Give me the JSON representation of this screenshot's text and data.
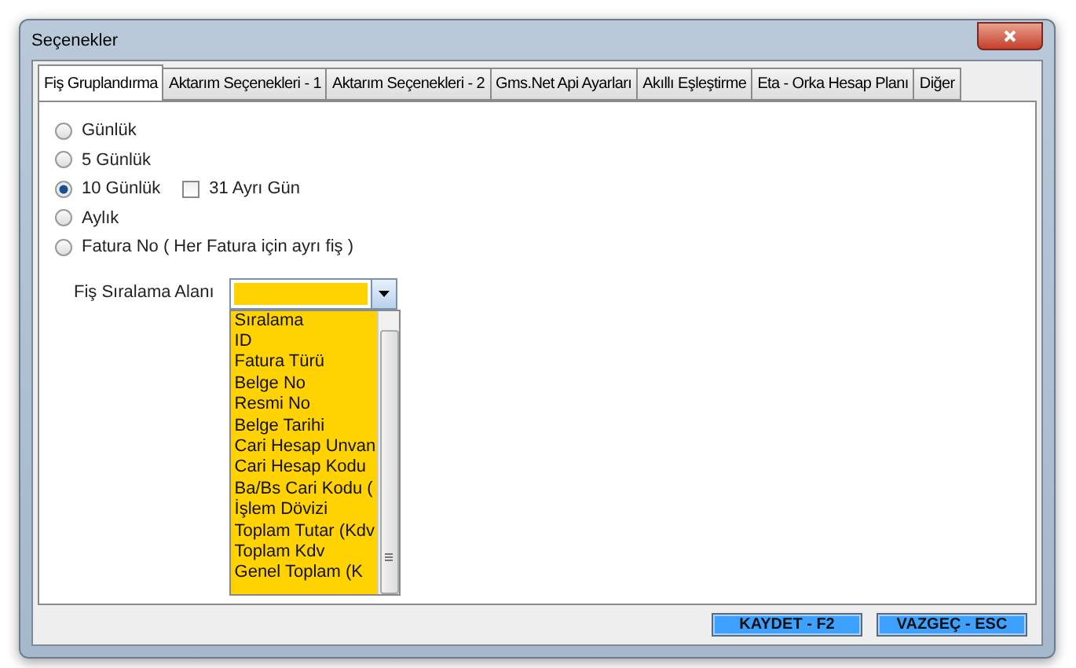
{
  "window": {
    "title": "Seçenekler"
  },
  "tabs": [
    {
      "label": "Fiş Gruplandırma",
      "selected": true
    },
    {
      "label": "Aktarım Seçenekleri - 1",
      "selected": false
    },
    {
      "label": "Aktarım Seçenekleri - 2",
      "selected": false
    },
    {
      "label": "Gms.Net Api Ayarları",
      "selected": false
    },
    {
      "label": "Akıllı Eşleştirme",
      "selected": false
    },
    {
      "label": "Eta - Orka Hesap Planı",
      "selected": false
    },
    {
      "label": "Diğer",
      "selected": false
    }
  ],
  "options": [
    {
      "kind": "radio",
      "label": "Günlük",
      "selected": false
    },
    {
      "kind": "radio",
      "label": "5 Günlük",
      "selected": false
    },
    {
      "kind": "radio",
      "label": "10 Günlük",
      "selected": true,
      "extra": {
        "label": "31 Ayrı Gün",
        "checked": false
      }
    },
    {
      "kind": "radio",
      "label": "Aylık",
      "selected": false
    },
    {
      "kind": "radio",
      "label": "Fatura No  ( Her Fatura için ayrı fiş )",
      "selected": false
    }
  ],
  "sort_field": {
    "label": "Fiş Sıralama Alanı",
    "items": [
      "Sıralama",
      "ID",
      "Fatura Türü",
      "Belge No",
      "Resmi No",
      "Belge Tarihi",
      "Cari Hesap Unvan",
      "Cari Hesap Kodu",
      "Ba/Bs Cari Kodu (",
      "İşlem Dövizi",
      "Toplam Tutar (Kdv",
      "Toplam Kdv",
      "Genel Toplam  (K"
    ]
  },
  "buttons": [
    "KAYDET - F2",
    "VAZGEÇ - ESC"
  ]
}
